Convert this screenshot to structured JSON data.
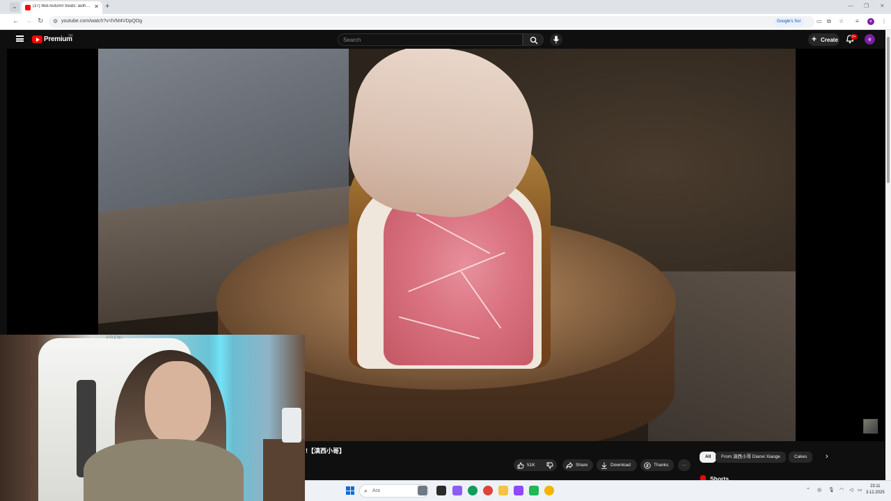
{
  "browser": {
    "tab_title": "(37) Mid-Autumn treats: auth…",
    "url": "youtube.com/watch?v=lVM4VDpQOg",
    "google_search_chip": "Google's Sor"
  },
  "header": {
    "brand": "Premium",
    "region": "TR",
    "search_placeholder": "Search",
    "create_label": "Create",
    "notifications_badge": "9+",
    "avatar_letter": "e"
  },
  "video": {
    "title": "!【滇西小哥】"
  },
  "actions": {
    "likes": "51K",
    "share": "Share",
    "download": "Download",
    "thanks": "Thanks",
    "more": "···"
  },
  "chips": [
    "All",
    "From 滇西小哥 Dianxi Xiaoge",
    "Cakes"
  ],
  "shorts_label": "Shorts",
  "taskbar": {
    "search_placeholder": "Ara",
    "time": "23:11",
    "date": "3.12.2025"
  },
  "colors": {
    "yt_red": "#ff0000",
    "background": "#0f0f0f",
    "avatar": "#7b1fa2"
  },
  "icons": {
    "menu": "hamburger-icon",
    "search": "search-icon",
    "mic": "mic-icon",
    "bell": "bell-icon",
    "like": "thumbs-up-icon",
    "dislike": "thumbs-down-icon",
    "share": "share-icon",
    "download": "download-icon",
    "thanks": "thanks-icon"
  }
}
